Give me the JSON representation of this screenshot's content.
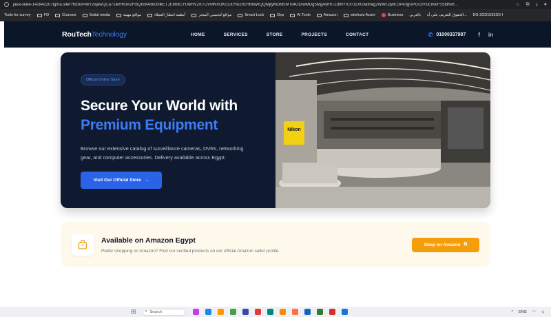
{
  "browser": {
    "url": "java-slate-14284220.figma.site/?fbclid=IwY2xjawQCa71leHRuA2FlbQIxMABicmlkETJEM0lCYUwRVZKTDVMNmJKc3J0YwZhcHBfaWQQMjIyMDM5MTc4ODIwMDg5MgABHl7ZdlNYX3T1O01wdrlag2WWCqwEDPe3gUPGC8YuEiwvF5Sldhvfl...",
    "bookmarks": [
      {
        "label": "Tools for survey",
        "icon": "none"
      },
      {
        "label": "FO",
        "icon": "folder"
      },
      {
        "label": "Courses",
        "icon": "folder"
      },
      {
        "label": "Sotial media",
        "icon": "folder"
      },
      {
        "label": "مواقع مهمة",
        "icon": "folder"
      },
      {
        "label": "أنظمة انتظار العملاء",
        "icon": "folder"
      },
      {
        "label": "مواقع لتحسين المتجر",
        "icon": "folder"
      },
      {
        "label": "Smart Lock",
        "icon": "folder"
      },
      {
        "label": "Dep",
        "icon": "folder"
      },
      {
        "label": "AI Tools",
        "icon": "folder"
      },
      {
        "label": "Amazon",
        "icon": "folder"
      },
      {
        "label": "wiwfows Azure",
        "icon": "folder"
      },
      {
        "label": "Business",
        "icon": "dot"
      },
      {
        "label": "بالعربي",
        "icon": "none"
      },
      {
        "label": "الحقوق التعريف على أه...",
        "icon": "none"
      },
      {
        "label": "DS-2CD1023G0-I",
        "icon": "none"
      }
    ]
  },
  "header": {
    "logo_main": "RouTech",
    "logo_accent": "Technology",
    "nav": [
      "HOME",
      "SERVICES",
      "STORE",
      "PROJECTS",
      "CONTACT"
    ],
    "phone": "01000337987",
    "socials": [
      "f",
      "in"
    ]
  },
  "hero": {
    "badge": "Official Online Store",
    "title_line1": "Secure Your World with",
    "title_line2": "Premium Equipment",
    "description": "Browse our extensive catalog of surveillance cameras, DVRs, networking gear, and computer accessories. Delivery available across Egypt.",
    "cta": "Visit Our Official Store",
    "store_sign": "Nikon"
  },
  "amazon": {
    "title": "Available on Amazon Egypt",
    "subtitle": "Prefer shopping on Amazon? Find our verified products on our official Amazon seller profile.",
    "button": "Shop on Amazon"
  },
  "taskbar": {
    "search": "Search",
    "lang": "ENG",
    "apps": [
      "#c23cf0",
      "#1e88e5",
      "#ff9800",
      "#43a047",
      "#3949ab",
      "#e53935",
      "#00897b",
      "#fb8c00",
      "#ff7043",
      "#1565c0",
      "#2e7d32",
      "#d32f2f",
      "#1976d2"
    ]
  },
  "colors": {
    "header_bg": "#0b1628",
    "hero_bg": "#0f1a30",
    "accent_blue": "#3d7cf5",
    "cta_blue": "#2a63e8",
    "amazon_bg": "#fff9ec",
    "amazon_orange": "#f59e0b"
  }
}
